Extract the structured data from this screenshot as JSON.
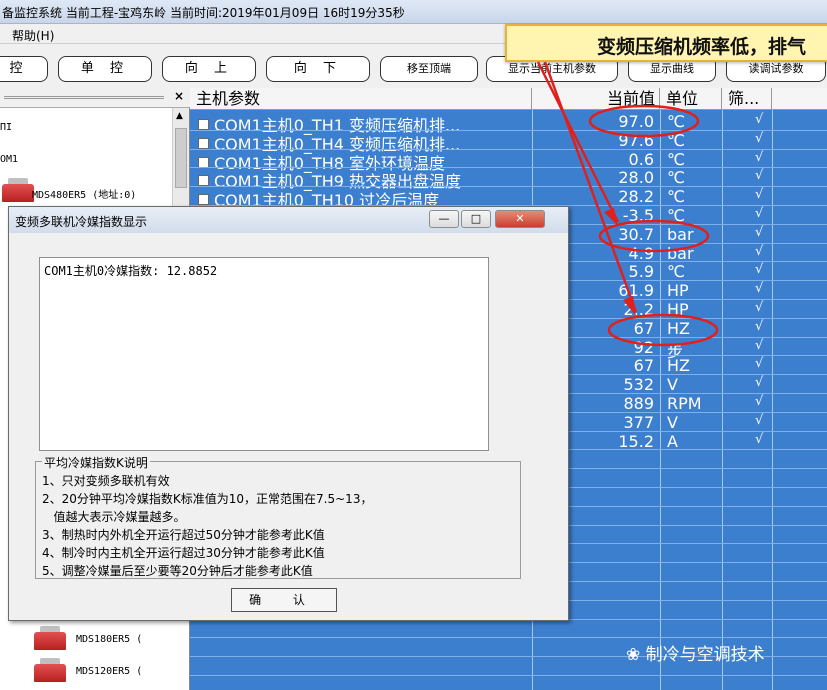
{
  "window": {
    "title": "备监控系统 当前工程-宝鸡东岭  当前时间:2019年01月09日 16时19分35秒"
  },
  "menu": {
    "help": "帮助(H)"
  },
  "toolbar": {
    "b1": "控",
    "b2": "单 控",
    "b3": "向 上",
    "b4": "向 下",
    "b5": "移至顶端",
    "b6": "显示当前主机参数",
    "b7": "显示曲线",
    "b8": "读调试参数"
  },
  "banner": {
    "text": "变频压缩机频率低，排气"
  },
  "tree": {
    "row1": "ΠI",
    "row2": "OM1",
    "row3": "MDS480ER5 (地址:0)",
    "row4": "MDS180ER5 (",
    "row5": "MDS120ER5 ("
  },
  "table": {
    "headers": {
      "name": "主机参数",
      "value": "当前值",
      "unit": "单位",
      "filter": "筛..."
    },
    "rows": [
      {
        "name": "COM1主机0_TH1 变频压缩机排...",
        "value": "97.0",
        "unit": "℃",
        "chk": "√"
      },
      {
        "name": "COM1主机0_TH4 变频压缩机排...",
        "value": "97.6",
        "unit": "℃",
        "chk": "√"
      },
      {
        "name": "COM1主机0_TH8 室外环境温度",
        "value": "0.6",
        "unit": "℃",
        "chk": "√"
      },
      {
        "name": "COM1主机0_TH9 热交器出盘温度",
        "value": "28.0",
        "unit": "℃",
        "chk": "√"
      },
      {
        "name": "COM1主机0_TH10 过冷后温度",
        "value": "28.2",
        "unit": "℃",
        "chk": "√"
      },
      {
        "name": "",
        "value": "-3.5",
        "unit": "℃",
        "chk": "√"
      },
      {
        "name": "",
        "value": "30.7",
        "unit": "bar",
        "chk": "√"
      },
      {
        "name": "",
        "value": "4.9",
        "unit": "bar",
        "chk": "√"
      },
      {
        "name": "",
        "value": "5.9",
        "unit": "℃",
        "chk": "√"
      },
      {
        "name": "",
        "value": "61.9",
        "unit": "HP",
        "chk": "√"
      },
      {
        "name": "",
        "value": "2..2",
        "unit": "HP",
        "chk": "√"
      },
      {
        "name": "",
        "value": "67",
        "unit": "HZ",
        "chk": "√"
      },
      {
        "name": "",
        "value": "92",
        "unit": "步",
        "chk": "√"
      },
      {
        "name": "",
        "value": "67",
        "unit": "HZ",
        "chk": "√"
      },
      {
        "name": "",
        "value": "532",
        "unit": "V",
        "chk": "√"
      },
      {
        "name": "",
        "value": "889",
        "unit": "RPM",
        "chk": "√"
      },
      {
        "name": "",
        "value": "377",
        "unit": "V",
        "chk": "√"
      },
      {
        "name": "",
        "value": "15.2",
        "unit": "A",
        "chk": "√"
      }
    ]
  },
  "dialog": {
    "title": "变频多联机冷媒指数显示",
    "content": "COM1主机0冷媒指数: 12.8852",
    "group_title": "平均冷媒指数K说明",
    "lines": [
      "1、只对变频多联机有效",
      "2、20分钟平均冷媒指数K标准值为10，正常范围在7.5~13，",
      "   值越大表示冷媒量越多。",
      "3、制热时内外机全开运行超过50分钟才能参考此K值",
      "4、制冷时内主机全开运行超过30分钟才能参考此K值",
      "5、调整冷媒量后至少要等20分钟后才能参考此K值"
    ],
    "ok": "确 认",
    "min": "—",
    "max": "□",
    "close": "✕"
  },
  "watermark": "制冷与空调技术",
  "colors": {
    "table_bg": "#3d7fcf",
    "annotation": "#e0201c",
    "banner_bg": "#fff4b0"
  }
}
